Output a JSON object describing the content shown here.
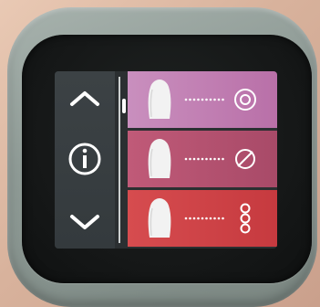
{
  "device": {
    "nav": {
      "up_icon": "chevron-up-icon",
      "info_icon": "info-icon",
      "down_icon": "chevron-down-icon"
    },
    "shade_rows": [
      {
        "icon": "tooth-icon",
        "level_icon": "target-circle-icon"
      },
      {
        "icon": "tooth-icon",
        "level_icon": "empty-set-icon"
      },
      {
        "icon": "tooth-icon",
        "level_icon": "three-circles-icon"
      }
    ]
  }
}
